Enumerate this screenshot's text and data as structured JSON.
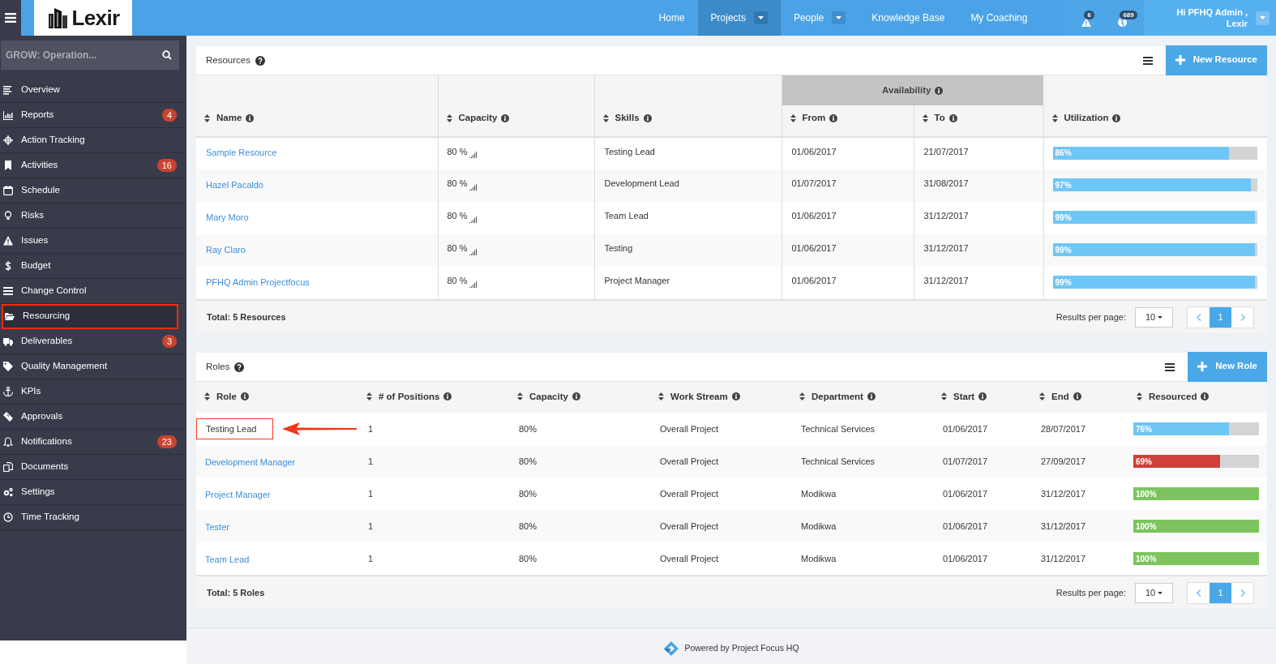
{
  "nav": {
    "logo_text": "Lexir",
    "items": [
      {
        "label": "Home",
        "selected": false,
        "dropdown": false
      },
      {
        "label": "Projects",
        "selected": true,
        "dropdown": true
      },
      {
        "label": "People",
        "selected": false,
        "dropdown": true
      },
      {
        "label": "Knowledge Base",
        "selected": false,
        "dropdown": false
      },
      {
        "label": "My Coaching",
        "selected": false,
        "dropdown": false
      }
    ],
    "alerts": [
      {
        "kind": "warning",
        "count": "6"
      },
      {
        "kind": "globe",
        "count": "689"
      }
    ],
    "user": {
      "greeting": "Hi PFHQ Admin ,",
      "org": "Lexir"
    }
  },
  "sidebar": {
    "search": {
      "value": "GROW: Operation..."
    },
    "items": [
      {
        "label": "Overview",
        "selected": false,
        "annotated": false
      },
      {
        "label": "Reports",
        "badge": "4",
        "selected": false,
        "annotated": false
      },
      {
        "label": "Action Tracking",
        "selected": false,
        "annotated": false
      },
      {
        "label": "Activities",
        "badge": "16",
        "selected": false,
        "annotated": false
      },
      {
        "label": "Schedule",
        "selected": false,
        "annotated": false
      },
      {
        "label": "Risks",
        "selected": false,
        "annotated": false
      },
      {
        "label": "Issues",
        "selected": false,
        "annotated": false
      },
      {
        "label": "Budget",
        "selected": false,
        "annotated": false
      },
      {
        "label": "Change Control",
        "selected": false,
        "annotated": false
      },
      {
        "label": "Resourcing",
        "selected": true,
        "annotated": true
      },
      {
        "label": "Deliverables",
        "badge": "3",
        "selected": false,
        "annotated": false
      },
      {
        "label": "Quality Management",
        "selected": false,
        "annotated": false
      },
      {
        "label": "KPIs",
        "selected": false,
        "annotated": false
      },
      {
        "label": "Approvals",
        "selected": false,
        "annotated": false
      },
      {
        "label": "Notifications",
        "badge": "23",
        "selected": false,
        "annotated": false
      },
      {
        "label": "Documents",
        "selected": false,
        "annotated": false
      },
      {
        "label": "Settings",
        "selected": false,
        "annotated": false
      },
      {
        "label": "Time Tracking",
        "selected": false,
        "annotated": false
      }
    ]
  },
  "resources": {
    "title": "Resources",
    "new_button": "New Resource",
    "group_header": "Availability",
    "columns": [
      "Name",
      "Capacity",
      "Skills",
      "From",
      "To",
      "Utilization"
    ],
    "rows": [
      {
        "name": "Sample Resource",
        "capacity": "80 %",
        "skills": "Testing Lead",
        "from": "01/06/2017",
        "to": "21/07/2017",
        "utilization": {
          "label": "86%",
          "level": 0.86
        }
      },
      {
        "name": "Hazel Pacaldo",
        "capacity": "80 %",
        "skills": "Development Lead",
        "from": "01/07/2017",
        "to": "31/08/2017",
        "utilization": {
          "label": "97%",
          "level": 0.97
        }
      },
      {
        "name": "Mary Moro",
        "capacity": "80 %",
        "skills": "Team Lead",
        "from": "01/06/2017",
        "to": "31/12/2017",
        "utilization": {
          "label": "99%",
          "level": 0.99
        }
      },
      {
        "name": "Ray Claro",
        "capacity": "80 %",
        "skills": "Testing",
        "from": "01/06/2017",
        "to": "31/12/2017",
        "utilization": {
          "label": "99%",
          "level": 0.99
        }
      },
      {
        "name": "PFHQ Admin Projectfocus",
        "capacity": "80 %",
        "skills": "Project Manager",
        "from": "01/06/2017",
        "to": "31/12/2017",
        "utilization": {
          "label": "99%",
          "level": 0.99
        }
      }
    ],
    "total": "Total: 5 Resources",
    "per_page_label": "Results per page:",
    "per_page": "10",
    "page": "1"
  },
  "roles": {
    "title": "Roles",
    "new_button": "New Role",
    "columns": [
      "Role",
      "# of Positions",
      "Capacity",
      "Work Stream",
      "Department",
      "Start",
      "End",
      "Resourced"
    ],
    "rows": [
      {
        "role": "Testing Lead",
        "positions": "1",
        "capacity": "80%",
        "work_stream": "Overall Project",
        "department": "Technical Services",
        "start": "01/06/2017",
        "end": "28/07/2017",
        "resourced": {
          "label": "76%",
          "level": 0.76,
          "color": "#6ec6f7"
        },
        "annotated": true
      },
      {
        "role": "Development Manager",
        "positions": "1",
        "capacity": "80%",
        "work_stream": "Overall Project",
        "department": "Technical Services",
        "start": "01/07/2017",
        "end": "27/09/2017",
        "resourced": {
          "label": "69%",
          "level": 0.69,
          "color": "#d13f3a"
        },
        "annotated": false
      },
      {
        "role": "Project Manager",
        "positions": "1",
        "capacity": "80%",
        "work_stream": "Overall Project",
        "department": "Modikwa",
        "start": "01/06/2017",
        "end": "31/12/2017",
        "resourced": {
          "label": "100%",
          "level": 1,
          "color": "#7dc45e"
        },
        "annotated": false
      },
      {
        "role": "Tester",
        "positions": "1",
        "capacity": "80%",
        "work_stream": "Overall Project",
        "department": "Modikwa",
        "start": "01/06/2017",
        "end": "31/12/2017",
        "resourced": {
          "label": "100%",
          "level": 1,
          "color": "#7dc45e"
        },
        "annotated": false
      },
      {
        "role": "Team Lead",
        "positions": "1",
        "capacity": "80%",
        "work_stream": "Overall Project",
        "department": "Modikwa",
        "start": "01/06/2017",
        "end": "31/12/2017",
        "resourced": {
          "label": "100%",
          "level": 1,
          "color": "#7dc45e"
        },
        "annotated": false
      }
    ],
    "total": "Total: 5 Roles",
    "per_page_label": "Results per page:",
    "per_page": "10",
    "page": "1"
  },
  "footer": "Powered by Project Focus HQ"
}
